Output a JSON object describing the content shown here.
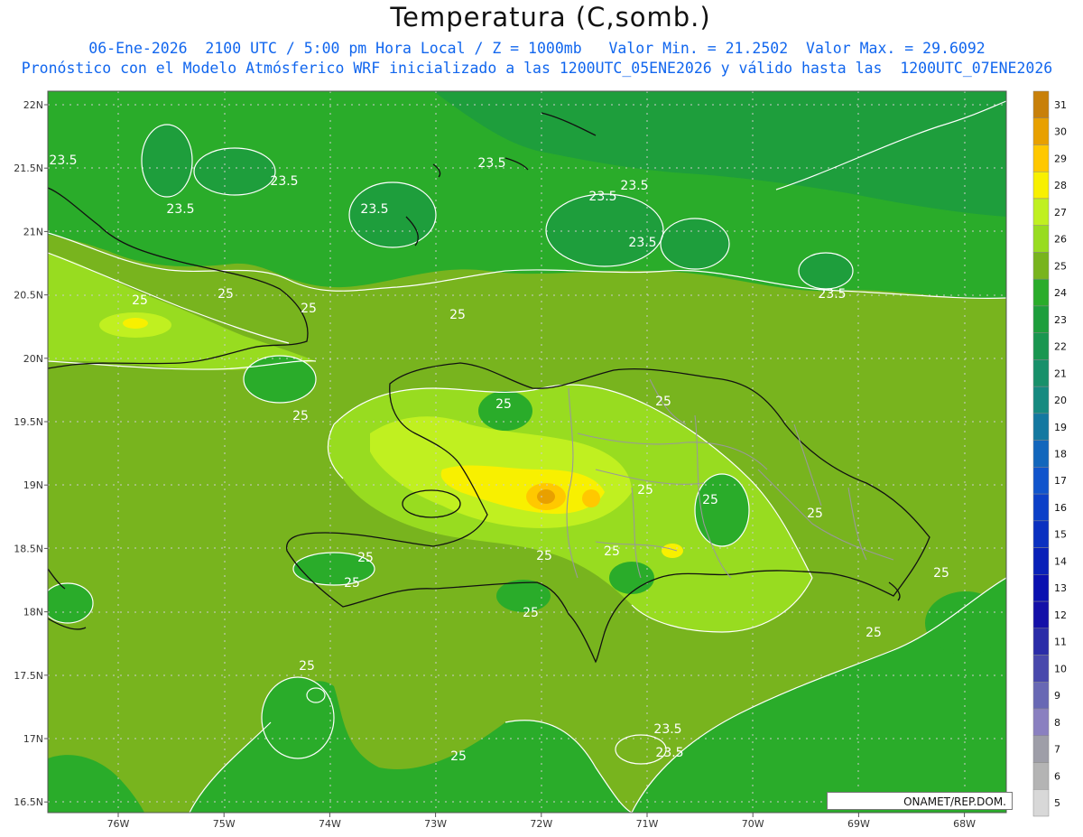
{
  "title": "Temperatura (C,somb.)",
  "subtitle_line1": "06-Ene-2026  2100 UTC / 5:00 pm Hora Local / Z = 1000mb   Valor Min. = 21.2502  Valor Max. = 29.6092",
  "subtitle_line2": "Pronóstico con el Modelo Atmósferico WRF inicializado a las 1200UTC_05ENE2026 y válido hasta las  1200UTC_07ENE2026",
  "lat_labels": [
    "22N",
    "21.5N",
    "21N",
    "20.5N",
    "20N",
    "19.5N",
    "19N",
    "18.5N",
    "18N",
    "17.5N",
    "17N",
    "16.5N"
  ],
  "lon_labels": [
    "76W",
    "75W",
    "74W",
    "73W",
    "72W",
    "71W",
    "70W",
    "69W",
    "68W"
  ],
  "colorbar": {
    "levels": [
      "31",
      "30",
      "29",
      "28",
      "27",
      "26",
      "25",
      "24",
      "23",
      "22",
      "21",
      "20",
      "19",
      "18",
      "17",
      "16",
      "15",
      "14",
      "13",
      "12",
      "11",
      "10",
      "9",
      "8",
      "7",
      "6",
      "5"
    ],
    "colors": [
      "#c8800a",
      "#e8a000",
      "#ffc800",
      "#f8f000",
      "#c0f020",
      "#98dc20",
      "#78b41e",
      "#2aac2a",
      "#1e9e3c",
      "#1a9650",
      "#18906a",
      "#168a80",
      "#1478a0",
      "#1266bc",
      "#1054cc",
      "#0c40c8",
      "#0a30c0",
      "#0820b8",
      "#0a10b0",
      "#1410a8",
      "#2a2ca8",
      "#4848ac",
      "#6868b4",
      "#8a80c0",
      "#9e9ea8",
      "#b4b4b4",
      "#d8d8d8"
    ]
  },
  "contour_labels": [
    {
      "text": "23.5"
    },
    {
      "text": "23.5"
    },
    {
      "text": "23.5"
    },
    {
      "text": "23.5"
    },
    {
      "text": "23.5"
    },
    {
      "text": "23.5"
    },
    {
      "text": "23.5"
    },
    {
      "text": "23.5"
    },
    {
      "text": "23.5"
    },
    {
      "text": "25"
    },
    {
      "text": "25"
    },
    {
      "text": "25"
    },
    {
      "text": "25"
    },
    {
      "text": "25"
    },
    {
      "text": "25"
    },
    {
      "text": "25"
    },
    {
      "text": "25"
    },
    {
      "text": "25"
    },
    {
      "text": "25"
    },
    {
      "text": "25"
    },
    {
      "text": "25"
    },
    {
      "text": "25"
    },
    {
      "text": "25"
    },
    {
      "text": "25"
    },
    {
      "text": "25"
    },
    {
      "text": "25"
    },
    {
      "text": "25"
    },
    {
      "text": "23.5"
    }
  ],
  "credit": "ONAMET/REP.DOM.",
  "colors": {
    "background_field": "#78b41e",
    "sea_green": "#2aac2a",
    "subtitle_blue": "#1166ee"
  }
}
